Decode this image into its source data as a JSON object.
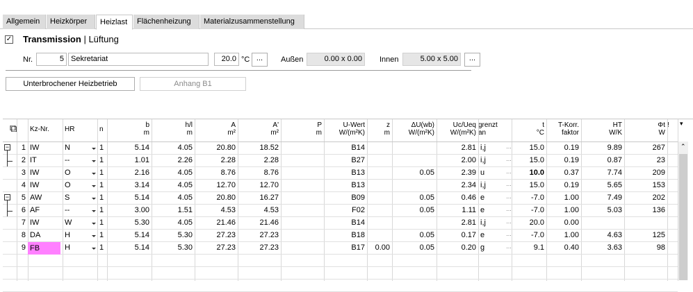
{
  "tabs": [
    {
      "label": "Allgemein",
      "active": false
    },
    {
      "label": "Heizkörper",
      "active": false
    },
    {
      "label": "Heizlast",
      "active": true
    },
    {
      "label": "Flächenheizung",
      "active": false
    },
    {
      "label": "Materialzusammenstellung",
      "active": false
    }
  ],
  "mode": {
    "checked": true,
    "transmission": "Transmission",
    "separator": "|",
    "lueftung": "Lüftung"
  },
  "room": {
    "nr_label": "Nr.",
    "nr_value": "5",
    "name_value": "Sekretariat",
    "temp_value": "20.0",
    "temp_unit": "°C",
    "ellipsis": "...",
    "aussen_label": "Außen",
    "aussen_value": "0.00 x 0.00",
    "innen_label": "Innen",
    "innen_value": "5.00 x 5.00"
  },
  "buttons": {
    "unterbrochen": "Unterbrochener Heizbetrieb",
    "anhang": "Anhang B1"
  },
  "columns": [
    {
      "top": "Kz-Nr.",
      "bottom": ""
    },
    {
      "top": "HR",
      "bottom": ""
    },
    {
      "top": "n",
      "bottom": ""
    },
    {
      "top": "b",
      "bottom": "m"
    },
    {
      "top": "h/l",
      "bottom": "m"
    },
    {
      "top": "A",
      "bottom": "m²"
    },
    {
      "top": "A'",
      "bottom": "m²"
    },
    {
      "top": "P",
      "bottom": "m"
    },
    {
      "top": "U-Wert",
      "bottom": "W/(m²K)"
    },
    {
      "top": "z",
      "bottom": "m"
    },
    {
      "top": "ΔU(wb)",
      "bottom": "W/(m²K)"
    },
    {
      "top": "Uc/Ueq",
      "bottom": "W/(m²K)"
    },
    {
      "top": "grenzt",
      "bottom": "an"
    },
    {
      "top": "t",
      "bottom": "°C"
    },
    {
      "top": "T-Korr.",
      "bottom": "faktor"
    },
    {
      "top": "HT",
      "bottom": "W/K"
    },
    {
      "top": "Φt",
      "bottom": "W"
    },
    {
      "top": "!",
      "bottom": ""
    }
  ],
  "rows": [
    {
      "no": "1",
      "kz": "IW",
      "hr": "N",
      "n": "1",
      "b": "5.14",
      "h": "4.05",
      "a": "20.80",
      "a2": "18.52",
      "p": "",
      "u": "B14",
      "z": "",
      "du": "",
      "uc": "2.81",
      "gr": "i,j",
      "t": "15.0",
      "tk": "0.19",
      "ht": "9.89",
      "phi": "267",
      "group": "start"
    },
    {
      "no": "2",
      "kz": "IT",
      "hr": "--",
      "n": "1",
      "b": "1.01",
      "h": "2.26",
      "a": "2.28",
      "a2": "2.28",
      "p": "",
      "u": "B27",
      "z": "",
      "du": "",
      "uc": "2.00",
      "gr": "i,j",
      "t": "15.0",
      "tk": "0.19",
      "ht": "0.87",
      "phi": "23",
      "group": "end"
    },
    {
      "no": "3",
      "kz": "IW",
      "hr": "O",
      "n": "1",
      "b": "2.16",
      "h": "4.05",
      "a": "8.76",
      "a2": "8.76",
      "p": "",
      "u": "B13",
      "z": "",
      "du": "0.05",
      "uc": "2.39",
      "gr": "u",
      "t": "10.0",
      "tk": "0.37",
      "ht": "7.74",
      "phi": "209",
      "bold_t": true
    },
    {
      "no": "4",
      "kz": "IW",
      "hr": "O",
      "n": "1",
      "b": "3.14",
      "h": "4.05",
      "a": "12.70",
      "a2": "12.70",
      "p": "",
      "u": "B13",
      "z": "",
      "du": "",
      "uc": "2.34",
      "gr": "i,j",
      "t": "15.0",
      "tk": "0.19",
      "ht": "5.65",
      "phi": "153"
    },
    {
      "no": "5",
      "kz": "AW",
      "hr": "S",
      "n": "1",
      "b": "5.14",
      "h": "4.05",
      "a": "20.80",
      "a2": "16.27",
      "p": "",
      "u": "B09",
      "z": "",
      "du": "0.05",
      "uc": "0.46",
      "gr": "e",
      "t": "-7.0",
      "tk": "1.00",
      "ht": "7.49",
      "phi": "202",
      "group": "start"
    },
    {
      "no": "6",
      "kz": "AF",
      "hr": "--",
      "n": "1",
      "b": "3.00",
      "h": "1.51",
      "a": "4.53",
      "a2": "4.53",
      "p": "",
      "u": "F02",
      "z": "",
      "du": "0.05",
      "uc": "1.11",
      "gr": "e",
      "t": "-7.0",
      "tk": "1.00",
      "ht": "5.03",
      "phi": "136",
      "group": "end"
    },
    {
      "no": "7",
      "kz": "IW",
      "hr": "W",
      "n": "1",
      "b": "5.30",
      "h": "4.05",
      "a": "21.46",
      "a2": "21.46",
      "p": "",
      "u": "B14",
      "z": "",
      "du": "",
      "uc": "2.81",
      "gr": "i,j",
      "t": "20.0",
      "tk": "0.00",
      "ht": "",
      "phi": ""
    },
    {
      "no": "8",
      "kz": "DA",
      "hr": "H",
      "n": "1",
      "b": "5.14",
      "h": "5.30",
      "a": "27.23",
      "a2": "27.23",
      "p": "",
      "u": "B18",
      "z": "",
      "du": "0.05",
      "uc": "0.17",
      "gr": "e",
      "t": "-7.0",
      "tk": "1.00",
      "ht": "4.63",
      "phi": "125"
    },
    {
      "no": "9",
      "kz": "FB",
      "hr": "H",
      "n": "1",
      "b": "5.14",
      "h": "5.30",
      "a": "27.23",
      "a2": "27.23",
      "p": "",
      "u": "B17",
      "z": "0.00",
      "du": "0.05",
      "uc": "0.20",
      "gr": "g",
      "t": "9.1",
      "tk": "0.40",
      "ht": "3.63",
      "phi": "98",
      "highlight": true
    }
  ],
  "colors": {
    "highlight": "#ff80ff",
    "tab_bg": "#dcdcdc",
    "grid_line": "#d8d8d8"
  }
}
